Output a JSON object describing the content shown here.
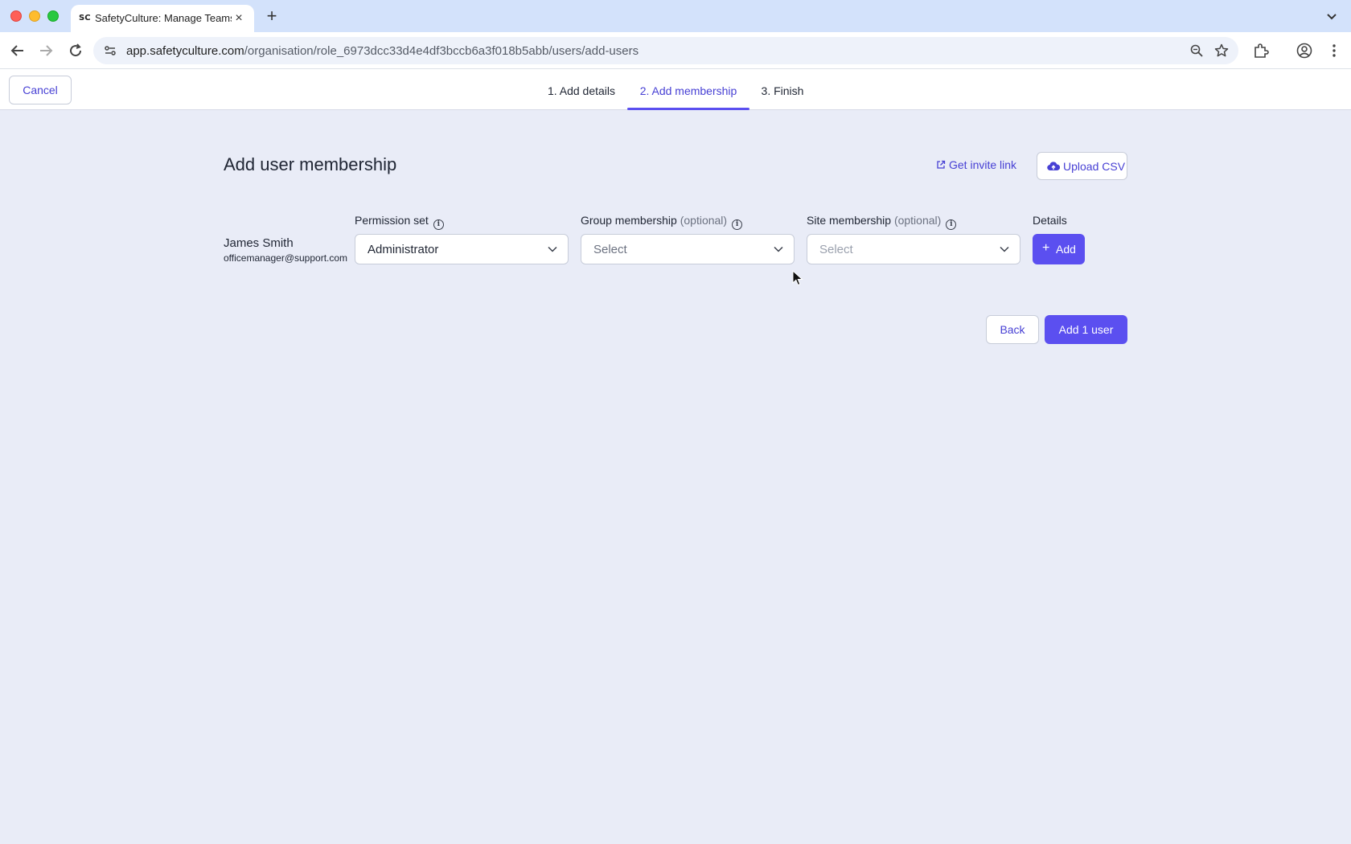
{
  "browser": {
    "tab_title": "SafetyCulture: Manage Teams",
    "favicon_text": "SC",
    "url_host": "app.safetyculture.com",
    "url_path": "/organisation/role_6973dcc33d4e4df3bccb6a3f018b5abb/users/add-users"
  },
  "header": {
    "cancel_label": "Cancel",
    "steps": [
      {
        "label": "1. Add details",
        "active": false
      },
      {
        "label": "2. Add membership",
        "active": true
      },
      {
        "label": "3. Finish",
        "active": false
      }
    ]
  },
  "main": {
    "title": "Add user membership",
    "invite_link_label": "Get invite link",
    "upload_csv_label": "Upload CSV",
    "columns": {
      "permission": "Permission set",
      "group": "Group membership",
      "site": "Site membership",
      "optional": "(optional)",
      "details": "Details"
    },
    "user": {
      "name": "James Smith",
      "email": "officemanager@support.com",
      "permission_value": "Administrator",
      "group_placeholder": "Select",
      "site_placeholder": "Select",
      "add_label": "Add"
    },
    "back_label": "Back",
    "submit_label": "Add 1 user"
  },
  "colors": {
    "accent": "#5b4ff0",
    "accent_text": "#4740d4",
    "page_bg": "#e9ecf7"
  }
}
